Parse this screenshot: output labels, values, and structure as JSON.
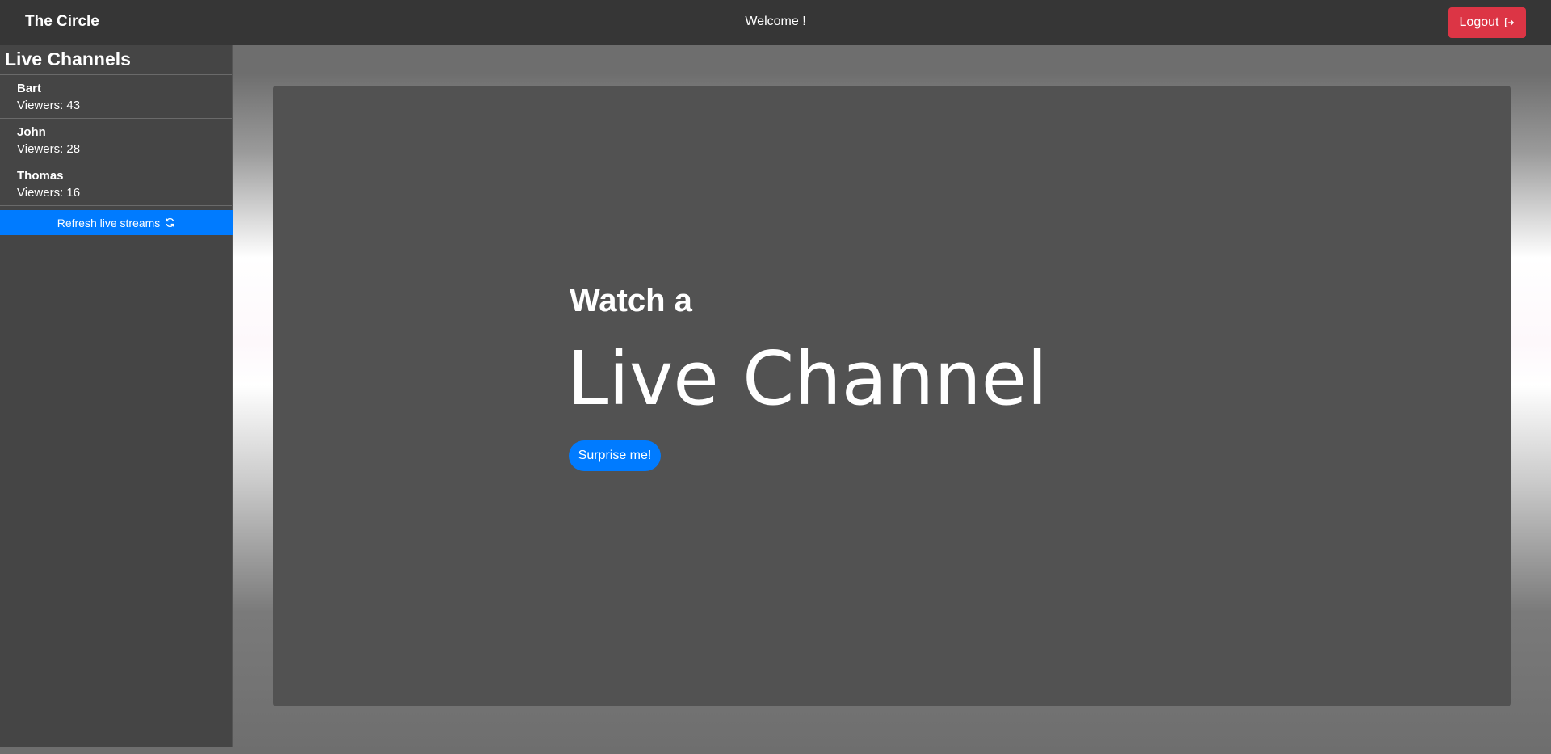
{
  "navbar": {
    "brand": "The Circle",
    "welcome": "Welcome !",
    "logout_label": "Logout",
    "logout_icon": "sign-out-icon"
  },
  "sidebar": {
    "title": "Live Channels",
    "channels": [
      {
        "name": "Bart",
        "viewers": "Viewers: 43"
      },
      {
        "name": "John",
        "viewers": "Viewers: 28"
      },
      {
        "name": "Thomas",
        "viewers": "Viewers: 16"
      }
    ],
    "refresh_label": "Refresh live streams",
    "refresh_icon": "refresh-icon"
  },
  "hero": {
    "line1": "Watch a",
    "line2": "Live Channel",
    "button_label": "Surprise me!"
  },
  "colors": {
    "navbar_bg": "#363636",
    "sidebar_bg": "#454545",
    "jumbotron_bg": "#525252",
    "primary": "#007bff",
    "danger": "#dc3545"
  }
}
